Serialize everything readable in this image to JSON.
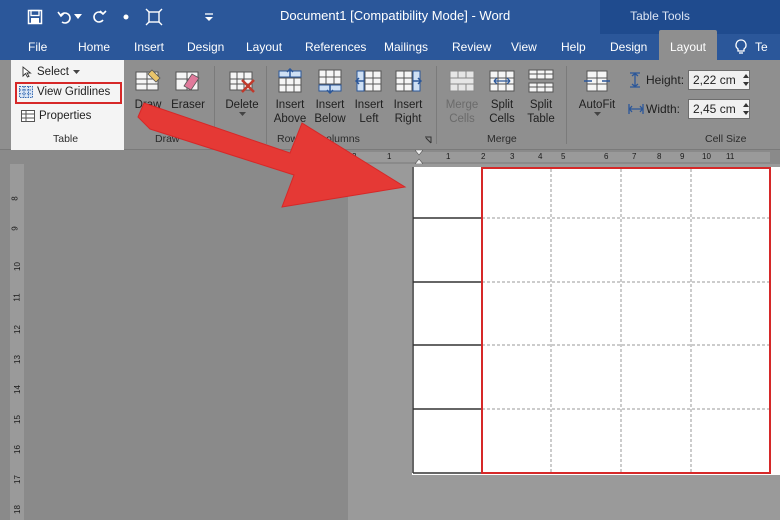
{
  "title_bar": {
    "document_title": "Document1 [Compatibility Mode]  -  Word",
    "contextual_group": "Table Tools",
    "quick_access": [
      "save-icon",
      "undo-icon",
      "redo-icon",
      "bullet-icon",
      "select-icon",
      "customize-icon"
    ]
  },
  "tabs": [
    {
      "label": "File"
    },
    {
      "label": "Home"
    },
    {
      "label": "Insert"
    },
    {
      "label": "Design"
    },
    {
      "label": "Layout"
    },
    {
      "label": "References"
    },
    {
      "label": "Mailings"
    },
    {
      "label": "Review"
    },
    {
      "label": "View"
    },
    {
      "label": "Help"
    },
    {
      "label": "Design"
    },
    {
      "label": "Layout"
    },
    {
      "label": "Te"
    }
  ],
  "ribbon": {
    "table_group": {
      "select": "Select",
      "view_gridlines": "View Gridlines",
      "properties": "Properties",
      "label": "Table"
    },
    "draw_group": {
      "draw_table": [
        "Draw",
        "T"
      ],
      "eraser": "Eraser",
      "label": "Draw"
    },
    "delete": "Delete",
    "rows_group": {
      "insert_above": [
        "Insert",
        "Above"
      ],
      "insert_below": [
        "Insert",
        "Below"
      ],
      "insert_left": [
        "Insert",
        "Left"
      ],
      "insert_right": [
        "Insert",
        "Right"
      ],
      "label_left": "Row",
      "label_right": "olumns"
    },
    "merge_group": {
      "merge_cells": [
        "Merge",
        "Cells"
      ],
      "split_cells": [
        "Split",
        "Cells"
      ],
      "split_table": [
        "Split",
        "Table"
      ],
      "label": "Merge"
    },
    "autofit": "AutoFit",
    "cell_size": {
      "height_label": "Height:",
      "height_value": "2,22 cm",
      "width_label": "Width:",
      "width_value": "2,45 cm",
      "label": "Cell Size"
    }
  },
  "ruler": {
    "top_ticks": [
      "2",
      "1",
      "1",
      "2",
      "3",
      "4",
      "5",
      "6",
      "7",
      "8",
      "9",
      "10",
      "11"
    ],
    "left_ticks": [
      "8",
      "9",
      "10",
      "11",
      "12",
      "13",
      "14",
      "15",
      "16",
      "17",
      "18"
    ]
  },
  "colors": {
    "word_blue": "#2b579a",
    "highlight_red": "#d62828"
  }
}
